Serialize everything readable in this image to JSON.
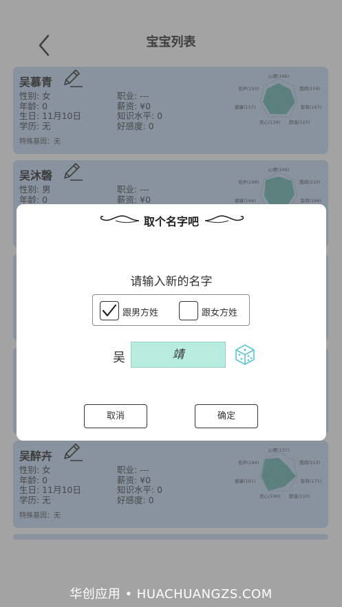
{
  "header": {
    "title": "宝宝列表"
  },
  "cards": [
    {
      "name": "吴慕青",
      "gender": "性别: 女",
      "age": "年龄: 0",
      "birthday": "生日: 11月10日",
      "education": "学历: 无",
      "job": "职业: ---",
      "salary": "薪资: ¥0",
      "knowledge": "知识水平: 0",
      "affinity": "好感度: 0",
      "gene": "特殊基因：无",
      "radar": {
        "top": "心情(168)",
        "tr": "饿病(159)",
        "right": "智商(167)",
        "br": "颜值(123)",
        "bl": "良心(139)",
        "left": "健康(117)",
        "tl": "名声(150)"
      }
    },
    {
      "name": "吴沐磬",
      "gender": "性别: 男",
      "age": "年龄: 0",
      "job": "职业: ---",
      "salary": "薪资: ¥0",
      "radar": {
        "top": "心情(149)",
        "tr": "饿病(210)",
        "right": "智商(166)",
        "left": "健康(144)",
        "tl": "名声(198)"
      }
    },
    {
      "name": "吴醉卉",
      "gender": "性别: 女",
      "age": "年龄: 0",
      "birthday": "生日: 11月10日",
      "education": "学历: 无",
      "job": "职业: ---",
      "salary": "薪资: ¥0",
      "knowledge": "知识水平: 0",
      "affinity": "好感度: 0",
      "gene": "特殊基因：无",
      "radar": {
        "top": "心情(137)",
        "tr": "饿病(113)",
        "right": "智商(171)",
        "br": "颜值(110)",
        "bl": "良心(190)",
        "left": "健康(161)",
        "tl": "名声(194)"
      }
    }
  ],
  "dialog": {
    "title": "取个名字吧",
    "prompt": "请输入新的名字",
    "follow_father": {
      "label": "跟男方姓",
      "checked": true
    },
    "follow_mother": {
      "label": "跟女方姓",
      "checked": false
    },
    "surname": "吴",
    "given_name": "靖",
    "cancel": "取消",
    "confirm": "确定"
  },
  "watermark": "华创应用 • HUACHUANGZS.COM",
  "colors": {
    "card_bg": "#b9cde4",
    "input_bg": "#b7ecdf",
    "radar_fill": "#4f9f94",
    "dice": "#5cc4cf"
  }
}
